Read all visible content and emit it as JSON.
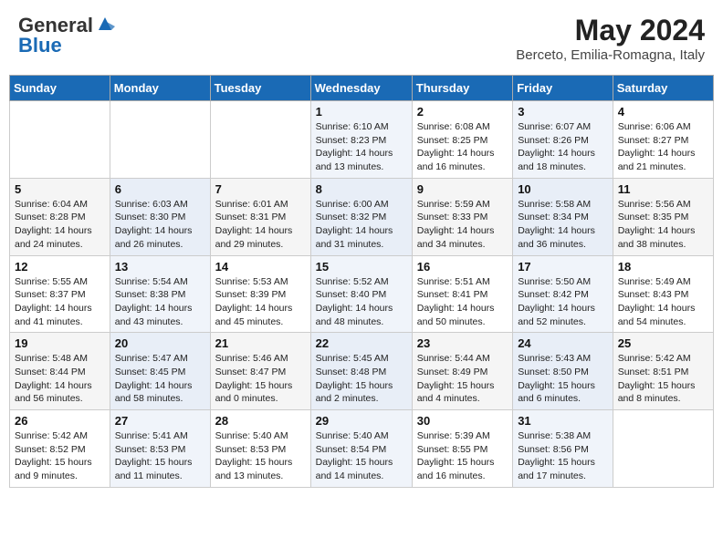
{
  "header": {
    "logo_general": "General",
    "logo_blue": "Blue",
    "month_year": "May 2024",
    "location": "Berceto, Emilia-Romagna, Italy"
  },
  "weekdays": [
    "Sunday",
    "Monday",
    "Tuesday",
    "Wednesday",
    "Thursday",
    "Friday",
    "Saturday"
  ],
  "weeks": [
    [
      {
        "day": "",
        "sunrise": "",
        "sunset": "",
        "daylight": ""
      },
      {
        "day": "",
        "sunrise": "",
        "sunset": "",
        "daylight": ""
      },
      {
        "day": "",
        "sunrise": "",
        "sunset": "",
        "daylight": ""
      },
      {
        "day": "1",
        "sunrise": "Sunrise: 6:10 AM",
        "sunset": "Sunset: 8:23 PM",
        "daylight": "Daylight: 14 hours and 13 minutes."
      },
      {
        "day": "2",
        "sunrise": "Sunrise: 6:08 AM",
        "sunset": "Sunset: 8:25 PM",
        "daylight": "Daylight: 14 hours and 16 minutes."
      },
      {
        "day": "3",
        "sunrise": "Sunrise: 6:07 AM",
        "sunset": "Sunset: 8:26 PM",
        "daylight": "Daylight: 14 hours and 18 minutes."
      },
      {
        "day": "4",
        "sunrise": "Sunrise: 6:06 AM",
        "sunset": "Sunset: 8:27 PM",
        "daylight": "Daylight: 14 hours and 21 minutes."
      }
    ],
    [
      {
        "day": "5",
        "sunrise": "Sunrise: 6:04 AM",
        "sunset": "Sunset: 8:28 PM",
        "daylight": "Daylight: 14 hours and 24 minutes."
      },
      {
        "day": "6",
        "sunrise": "Sunrise: 6:03 AM",
        "sunset": "Sunset: 8:30 PM",
        "daylight": "Daylight: 14 hours and 26 minutes."
      },
      {
        "day": "7",
        "sunrise": "Sunrise: 6:01 AM",
        "sunset": "Sunset: 8:31 PM",
        "daylight": "Daylight: 14 hours and 29 minutes."
      },
      {
        "day": "8",
        "sunrise": "Sunrise: 6:00 AM",
        "sunset": "Sunset: 8:32 PM",
        "daylight": "Daylight: 14 hours and 31 minutes."
      },
      {
        "day": "9",
        "sunrise": "Sunrise: 5:59 AM",
        "sunset": "Sunset: 8:33 PM",
        "daylight": "Daylight: 14 hours and 34 minutes."
      },
      {
        "day": "10",
        "sunrise": "Sunrise: 5:58 AM",
        "sunset": "Sunset: 8:34 PM",
        "daylight": "Daylight: 14 hours and 36 minutes."
      },
      {
        "day": "11",
        "sunrise": "Sunrise: 5:56 AM",
        "sunset": "Sunset: 8:35 PM",
        "daylight": "Daylight: 14 hours and 38 minutes."
      }
    ],
    [
      {
        "day": "12",
        "sunrise": "Sunrise: 5:55 AM",
        "sunset": "Sunset: 8:37 PM",
        "daylight": "Daylight: 14 hours and 41 minutes."
      },
      {
        "day": "13",
        "sunrise": "Sunrise: 5:54 AM",
        "sunset": "Sunset: 8:38 PM",
        "daylight": "Daylight: 14 hours and 43 minutes."
      },
      {
        "day": "14",
        "sunrise": "Sunrise: 5:53 AM",
        "sunset": "Sunset: 8:39 PM",
        "daylight": "Daylight: 14 hours and 45 minutes."
      },
      {
        "day": "15",
        "sunrise": "Sunrise: 5:52 AM",
        "sunset": "Sunset: 8:40 PM",
        "daylight": "Daylight: 14 hours and 48 minutes."
      },
      {
        "day": "16",
        "sunrise": "Sunrise: 5:51 AM",
        "sunset": "Sunset: 8:41 PM",
        "daylight": "Daylight: 14 hours and 50 minutes."
      },
      {
        "day": "17",
        "sunrise": "Sunrise: 5:50 AM",
        "sunset": "Sunset: 8:42 PM",
        "daylight": "Daylight: 14 hours and 52 minutes."
      },
      {
        "day": "18",
        "sunrise": "Sunrise: 5:49 AM",
        "sunset": "Sunset: 8:43 PM",
        "daylight": "Daylight: 14 hours and 54 minutes."
      }
    ],
    [
      {
        "day": "19",
        "sunrise": "Sunrise: 5:48 AM",
        "sunset": "Sunset: 8:44 PM",
        "daylight": "Daylight: 14 hours and 56 minutes."
      },
      {
        "day": "20",
        "sunrise": "Sunrise: 5:47 AM",
        "sunset": "Sunset: 8:45 PM",
        "daylight": "Daylight: 14 hours and 58 minutes."
      },
      {
        "day": "21",
        "sunrise": "Sunrise: 5:46 AM",
        "sunset": "Sunset: 8:47 PM",
        "daylight": "Daylight: 15 hours and 0 minutes."
      },
      {
        "day": "22",
        "sunrise": "Sunrise: 5:45 AM",
        "sunset": "Sunset: 8:48 PM",
        "daylight": "Daylight: 15 hours and 2 minutes."
      },
      {
        "day": "23",
        "sunrise": "Sunrise: 5:44 AM",
        "sunset": "Sunset: 8:49 PM",
        "daylight": "Daylight: 15 hours and 4 minutes."
      },
      {
        "day": "24",
        "sunrise": "Sunrise: 5:43 AM",
        "sunset": "Sunset: 8:50 PM",
        "daylight": "Daylight: 15 hours and 6 minutes."
      },
      {
        "day": "25",
        "sunrise": "Sunrise: 5:42 AM",
        "sunset": "Sunset: 8:51 PM",
        "daylight": "Daylight: 15 hours and 8 minutes."
      }
    ],
    [
      {
        "day": "26",
        "sunrise": "Sunrise: 5:42 AM",
        "sunset": "Sunset: 8:52 PM",
        "daylight": "Daylight: 15 hours and 9 minutes."
      },
      {
        "day": "27",
        "sunrise": "Sunrise: 5:41 AM",
        "sunset": "Sunset: 8:53 PM",
        "daylight": "Daylight: 15 hours and 11 minutes."
      },
      {
        "day": "28",
        "sunrise": "Sunrise: 5:40 AM",
        "sunset": "Sunset: 8:53 PM",
        "daylight": "Daylight: 15 hours and 13 minutes."
      },
      {
        "day": "29",
        "sunrise": "Sunrise: 5:40 AM",
        "sunset": "Sunset: 8:54 PM",
        "daylight": "Daylight: 15 hours and 14 minutes."
      },
      {
        "day": "30",
        "sunrise": "Sunrise: 5:39 AM",
        "sunset": "Sunset: 8:55 PM",
        "daylight": "Daylight: 15 hours and 16 minutes."
      },
      {
        "day": "31",
        "sunrise": "Sunrise: 5:38 AM",
        "sunset": "Sunset: 8:56 PM",
        "daylight": "Daylight: 15 hours and 17 minutes."
      },
      {
        "day": "",
        "sunrise": "",
        "sunset": "",
        "daylight": ""
      }
    ]
  ]
}
